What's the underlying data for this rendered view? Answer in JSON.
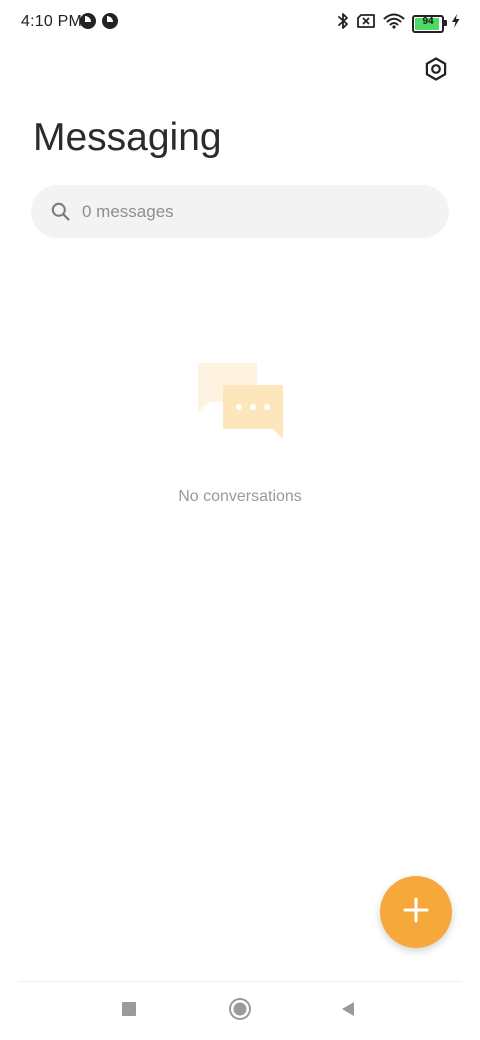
{
  "status_bar": {
    "time": "4:10 PM",
    "battery_level": "94",
    "battery_fraction": 0.94,
    "icons": [
      "app-notification-icon",
      "app-notification-icon",
      "bluetooth-icon",
      "no-sim-icon",
      "wifi-icon",
      "battery-icon",
      "charging-icon"
    ]
  },
  "header": {
    "title": "Messaging",
    "settings_icon": "settings-hexagon-icon"
  },
  "search": {
    "placeholder": "0 messages",
    "icon": "search-icon"
  },
  "empty_state": {
    "icon": "chat-bubbles-icon",
    "text": "No conversations"
  },
  "fab": {
    "icon": "plus-icon"
  },
  "nav_bar": {
    "buttons": [
      "recents-square-icon",
      "home-circle-icon",
      "back-triangle-icon"
    ]
  },
  "colors": {
    "accent": "#f6a93b",
    "illustration_light": "#fdf3e0",
    "illustration_main": "#fde6bb"
  }
}
